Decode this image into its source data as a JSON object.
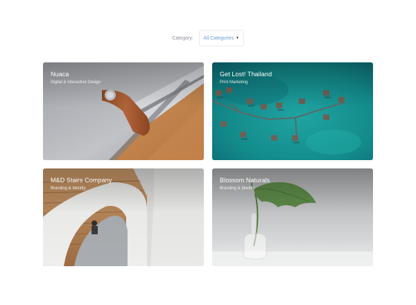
{
  "filter": {
    "label": "Category:",
    "selected": "All Categories",
    "caret_icon": "caret-down-icon"
  },
  "portfolio": {
    "items": [
      {
        "title": "Nuaca",
        "category": "Digital & Interactive Design",
        "image": "laptop-sleeve-photo"
      },
      {
        "title": "Get Lost! Thailand",
        "category": "Print Marketing",
        "image": "overwater-bungalows-photo"
      },
      {
        "title": "M&D Stairs Company",
        "category": "Branding & Identity",
        "image": "spiral-staircase-photo"
      },
      {
        "title": "Blossom Naturals",
        "category": "Branding & Identity",
        "image": "monstera-vase-photo"
      }
    ]
  },
  "colors": {
    "filter_value": "#6b9bd1",
    "filter_label": "#8a8f98",
    "card_text": "#ffffff"
  }
}
